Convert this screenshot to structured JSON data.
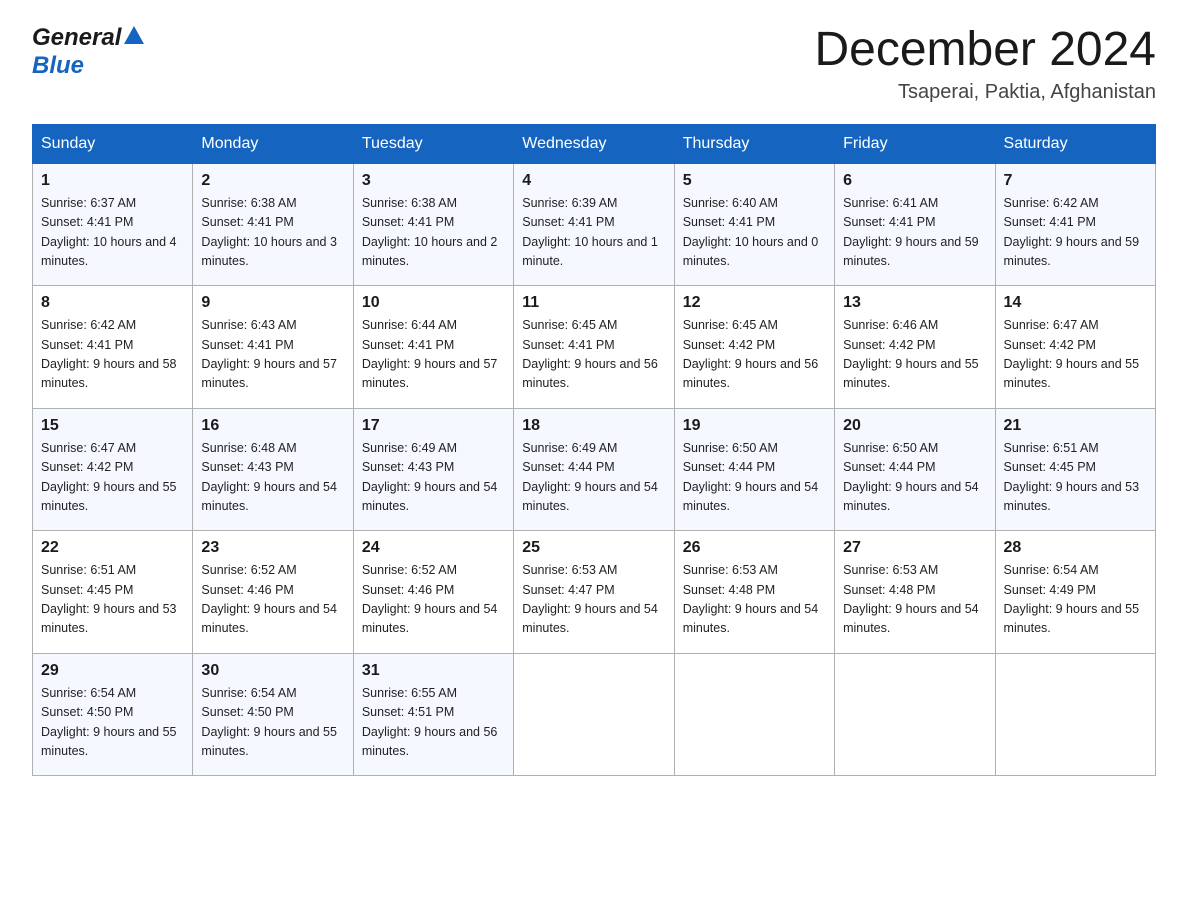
{
  "header": {
    "logo_general": "General",
    "logo_blue": "Blue",
    "month_title": "December 2024",
    "location": "Tsaperai, Paktia, Afghanistan"
  },
  "weekdays": [
    "Sunday",
    "Monday",
    "Tuesday",
    "Wednesday",
    "Thursday",
    "Friday",
    "Saturday"
  ],
  "weeks": [
    [
      {
        "day": "1",
        "sunrise": "6:37 AM",
        "sunset": "4:41 PM",
        "daylight": "10 hours and 4 minutes."
      },
      {
        "day": "2",
        "sunrise": "6:38 AM",
        "sunset": "4:41 PM",
        "daylight": "10 hours and 3 minutes."
      },
      {
        "day": "3",
        "sunrise": "6:38 AM",
        "sunset": "4:41 PM",
        "daylight": "10 hours and 2 minutes."
      },
      {
        "day": "4",
        "sunrise": "6:39 AM",
        "sunset": "4:41 PM",
        "daylight": "10 hours and 1 minute."
      },
      {
        "day": "5",
        "sunrise": "6:40 AM",
        "sunset": "4:41 PM",
        "daylight": "10 hours and 0 minutes."
      },
      {
        "day": "6",
        "sunrise": "6:41 AM",
        "sunset": "4:41 PM",
        "daylight": "9 hours and 59 minutes."
      },
      {
        "day": "7",
        "sunrise": "6:42 AM",
        "sunset": "4:41 PM",
        "daylight": "9 hours and 59 minutes."
      }
    ],
    [
      {
        "day": "8",
        "sunrise": "6:42 AM",
        "sunset": "4:41 PM",
        "daylight": "9 hours and 58 minutes."
      },
      {
        "day": "9",
        "sunrise": "6:43 AM",
        "sunset": "4:41 PM",
        "daylight": "9 hours and 57 minutes."
      },
      {
        "day": "10",
        "sunrise": "6:44 AM",
        "sunset": "4:41 PM",
        "daylight": "9 hours and 57 minutes."
      },
      {
        "day": "11",
        "sunrise": "6:45 AM",
        "sunset": "4:41 PM",
        "daylight": "9 hours and 56 minutes."
      },
      {
        "day": "12",
        "sunrise": "6:45 AM",
        "sunset": "4:42 PM",
        "daylight": "9 hours and 56 minutes."
      },
      {
        "day": "13",
        "sunrise": "6:46 AM",
        "sunset": "4:42 PM",
        "daylight": "9 hours and 55 minutes."
      },
      {
        "day": "14",
        "sunrise": "6:47 AM",
        "sunset": "4:42 PM",
        "daylight": "9 hours and 55 minutes."
      }
    ],
    [
      {
        "day": "15",
        "sunrise": "6:47 AM",
        "sunset": "4:42 PM",
        "daylight": "9 hours and 55 minutes."
      },
      {
        "day": "16",
        "sunrise": "6:48 AM",
        "sunset": "4:43 PM",
        "daylight": "9 hours and 54 minutes."
      },
      {
        "day": "17",
        "sunrise": "6:49 AM",
        "sunset": "4:43 PM",
        "daylight": "9 hours and 54 minutes."
      },
      {
        "day": "18",
        "sunrise": "6:49 AM",
        "sunset": "4:44 PM",
        "daylight": "9 hours and 54 minutes."
      },
      {
        "day": "19",
        "sunrise": "6:50 AM",
        "sunset": "4:44 PM",
        "daylight": "9 hours and 54 minutes."
      },
      {
        "day": "20",
        "sunrise": "6:50 AM",
        "sunset": "4:44 PM",
        "daylight": "9 hours and 54 minutes."
      },
      {
        "day": "21",
        "sunrise": "6:51 AM",
        "sunset": "4:45 PM",
        "daylight": "9 hours and 53 minutes."
      }
    ],
    [
      {
        "day": "22",
        "sunrise": "6:51 AM",
        "sunset": "4:45 PM",
        "daylight": "9 hours and 53 minutes."
      },
      {
        "day": "23",
        "sunrise": "6:52 AM",
        "sunset": "4:46 PM",
        "daylight": "9 hours and 54 minutes."
      },
      {
        "day": "24",
        "sunrise": "6:52 AM",
        "sunset": "4:46 PM",
        "daylight": "9 hours and 54 minutes."
      },
      {
        "day": "25",
        "sunrise": "6:53 AM",
        "sunset": "4:47 PM",
        "daylight": "9 hours and 54 minutes."
      },
      {
        "day": "26",
        "sunrise": "6:53 AM",
        "sunset": "4:48 PM",
        "daylight": "9 hours and 54 minutes."
      },
      {
        "day": "27",
        "sunrise": "6:53 AM",
        "sunset": "4:48 PM",
        "daylight": "9 hours and 54 minutes."
      },
      {
        "day": "28",
        "sunrise": "6:54 AM",
        "sunset": "4:49 PM",
        "daylight": "9 hours and 55 minutes."
      }
    ],
    [
      {
        "day": "29",
        "sunrise": "6:54 AM",
        "sunset": "4:50 PM",
        "daylight": "9 hours and 55 minutes."
      },
      {
        "day": "30",
        "sunrise": "6:54 AM",
        "sunset": "4:50 PM",
        "daylight": "9 hours and 55 minutes."
      },
      {
        "day": "31",
        "sunrise": "6:55 AM",
        "sunset": "4:51 PM",
        "daylight": "9 hours and 56 minutes."
      },
      null,
      null,
      null,
      null
    ]
  ],
  "labels": {
    "sunrise": "Sunrise:",
    "sunset": "Sunset:",
    "daylight": "Daylight:"
  }
}
